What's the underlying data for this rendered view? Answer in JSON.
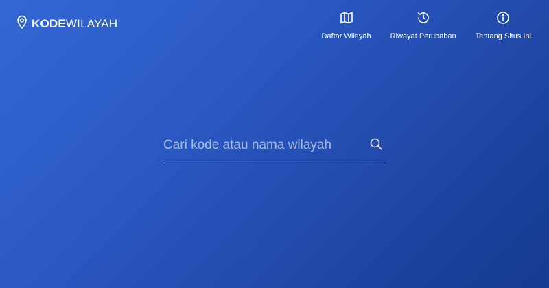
{
  "brand": {
    "name_bold": "KODE",
    "name_light": "WILAYAH",
    "icon": "map-pin-icon"
  },
  "nav": {
    "items": [
      {
        "label": "Daftar Wilayah",
        "icon": "map-icon"
      },
      {
        "label": "Riwayat Perubahan",
        "icon": "history-icon"
      },
      {
        "label": "Tentang Situs Ini",
        "icon": "info-icon"
      }
    ]
  },
  "search": {
    "placeholder": "Cari kode atau nama wilayah",
    "value": "",
    "icon": "search-icon"
  },
  "colors": {
    "gradient_start": "#3468d6",
    "gradient_end": "#163a8e",
    "text": "#ffffff"
  }
}
